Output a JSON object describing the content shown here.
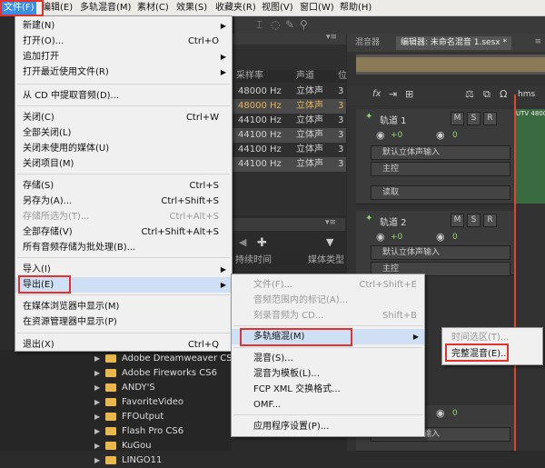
{
  "menubar": {
    "items": [
      {
        "label": "文件(F)",
        "active": true
      },
      {
        "label": "编辑(E)"
      },
      {
        "label": "多轨混音(M)"
      },
      {
        "label": "素材(C)"
      },
      {
        "label": "效果(S)"
      },
      {
        "label": "收藏夹(R)"
      },
      {
        "label": "视图(V)"
      },
      {
        "label": "窗口(W)"
      },
      {
        "label": "帮助(H)"
      }
    ]
  },
  "file_menu": {
    "items": [
      {
        "label": "新建(N)",
        "shortcut": "",
        "submenu": true
      },
      {
        "label": "打开(O)...",
        "shortcut": "Ctrl+O"
      },
      {
        "label": "追加打开",
        "shortcut": "",
        "submenu": true
      },
      {
        "label": "打开最近使用文件(R)",
        "shortcut": "",
        "submenu": true
      },
      {
        "label": "从 CD 中提取音频(D)...",
        "shortcut": ""
      },
      {
        "label": "关闭(C)",
        "shortcut": "Ctrl+W"
      },
      {
        "label": "全部关闭(L)",
        "shortcut": ""
      },
      {
        "label": "关闭未使用的媒体(U)",
        "shortcut": ""
      },
      {
        "label": "关闭项目(M)",
        "shortcut": ""
      },
      {
        "label": "存储(S)",
        "shortcut": "Ctrl+S"
      },
      {
        "label": "另存为(A)...",
        "shortcut": "Ctrl+Shift+S"
      },
      {
        "label": "存储所选为(T)...",
        "shortcut": "Ctrl+Alt+S",
        "disabled": true
      },
      {
        "label": "全部存储(V)",
        "shortcut": "Ctrl+Shift+Alt+S"
      },
      {
        "label": "所有音频存储为批处理(B)...",
        "shortcut": ""
      },
      {
        "label": "导入(I)",
        "shortcut": "",
        "submenu": true
      },
      {
        "label": "导出(E)",
        "shortcut": "",
        "submenu": true,
        "highlighted": true
      },
      {
        "label": "在媒体浏览器中显示(M)",
        "shortcut": ""
      },
      {
        "label": "在资源管理器中显示(P)",
        "shortcut": ""
      },
      {
        "label": "退出(X)",
        "shortcut": "Ctrl+Q"
      }
    ]
  },
  "export_menu": {
    "items": [
      {
        "label": "文件(F)...",
        "shortcut": "Ctrl+Shift+E",
        "disabled": true
      },
      {
        "label": "音频范围内的标记(A)...",
        "shortcut": "",
        "disabled": true
      },
      {
        "label": "刻录音频为 CD...",
        "shortcut": "Shift+B",
        "disabled": true
      },
      {
        "label": "多轨缩混(M)",
        "shortcut": "",
        "submenu": true,
        "highlighted": true
      },
      {
        "label": "混音(S)...",
        "shortcut": ""
      },
      {
        "label": "混音为模板(L)...",
        "shortcut": ""
      },
      {
        "label": "FCP XML 交换格式...",
        "shortcut": ""
      },
      {
        "label": "OMF...",
        "shortcut": ""
      },
      {
        "label": "应用程序设置(P)...",
        "shortcut": ""
      }
    ]
  },
  "mixdown_menu": {
    "items": [
      {
        "label": "时间选区(T)...",
        "disabled": true
      },
      {
        "label": "完整混音(E)...",
        "highlighted": true
      }
    ]
  },
  "files_panel": {
    "col_samplerate": "采样率",
    "col_channels": "声道",
    "col_bits": "位",
    "rows": [
      {
        "rate": "48000 Hz",
        "ch": "立体声",
        "bits": "3"
      },
      {
        "rate": "48000 Hz",
        "ch": "立体声",
        "bits": "3",
        "highlight": true
      },
      {
        "rate": "44100 Hz",
        "ch": "立体声",
        "bits": "3"
      },
      {
        "rate": "44100 Hz",
        "ch": "立体声",
        "bits": "3"
      },
      {
        "rate": "44100 Hz",
        "ch": "立体声",
        "bits": "3"
      },
      {
        "rate": "44100 Hz",
        "ch": "立体声",
        "bits": "3"
      }
    ]
  },
  "lower_panel": {
    "col_duration": "持续时间",
    "col_media_type": "媒体类型"
  },
  "folders": [
    "Adobe Dreamweaver CS6",
    "Adobe Fireworks CS6",
    "ANDY'S",
    "FavoriteVideo",
    "FFOutput",
    "Flash Pro CS6",
    "KuGou",
    "LINGO11"
  ],
  "editor": {
    "tab_mixer": "混音器",
    "tab_editor": "编辑器: 未命名混音 1.sesx *",
    "time_label": "hms",
    "wave_label": "UTV 48000",
    "track1": {
      "title": "轨道 1",
      "volume": "+0",
      "pan": "0",
      "input": "默认立体声输入",
      "output": "主控",
      "mode": "读取"
    },
    "track2": {
      "title": "轨道 2",
      "volume": "+0",
      "pan": "0",
      "input": "默认立体声输入",
      "output": "主控"
    },
    "track3": {
      "volume": "+0",
      "pan": "0",
      "input": "默认立体声输入"
    }
  }
}
